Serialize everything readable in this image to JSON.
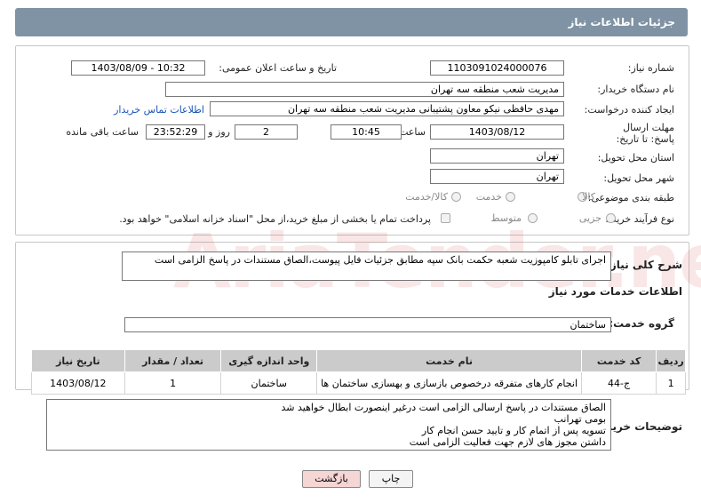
{
  "header": {
    "title": "جزئیات اطلاعات نیاز"
  },
  "form": {
    "need_number_label": "شماره نیاز:",
    "need_number": "1103091024000076",
    "announce_label": "تاریخ و ساعت اعلان عمومی:",
    "announce_value": "1403/08/09 - 10:32",
    "buyer_label": "نام دستگاه خریدار:",
    "buyer_value": "مدیریت شعب منطقه سه تهران",
    "creator_label": "ایجاد کننده درخواست:",
    "creator_value": "مهدی حافظی نیکو معاون پشتیبانی مدیریت شعب منطقه سه تهران",
    "contact_link": "اطلاعات تماس خریدار",
    "deadline_label": "مهلت ارسال پاسخ: تا تاریخ:",
    "deadline_date": "1403/08/12",
    "time_label": "ساعت",
    "deadline_time": "10:45",
    "days_value": "2",
    "days_label": "روز و",
    "remaining_time": "23:52:29",
    "remaining_label": "ساعت باقی مانده",
    "province_label": "استان محل تحویل:",
    "province_value": "تهران",
    "city_label": "شهر محل تحویل:",
    "city_value": "تهران",
    "category_label": "طبقه بندی موضوعی:",
    "category_options": [
      "کالا",
      "خدمت",
      "کالا/خدمت"
    ],
    "process_label": "نوع فرآیند خرید :",
    "process_options": [
      "جزیی",
      "متوسط"
    ],
    "payment_note": "پرداخت تمام یا بخشی از مبلغ خرید،از محل \"اسناد خزانه اسلامی\" خواهد بود."
  },
  "description": {
    "label": "شرح کلی نیاز:",
    "text": "اجرای تابلو کامپوزیت شعبه حکمت بانک سپه مطابق جزئیات فایل پیوست،الصاق مستندات در پاسخ الزامی است"
  },
  "services": {
    "title": "اطلاعات خدمات مورد نیاز",
    "group_label": "گروه خدمت:",
    "group_value": "ساختمان",
    "columns": [
      "ردیف",
      "کد خدمت",
      "نام خدمت",
      "واحد اندازه گیری",
      "تعداد / مقدار",
      "تاریخ نیاز"
    ],
    "rows": [
      [
        "1",
        "ج-44",
        "انجام کارهای متفرقه درخصوص بازسازی و بهسازی ساختمان ها",
        "ساختمان",
        "1",
        "1403/08/12"
      ]
    ]
  },
  "buyer_notes": {
    "label": "توضیحات خریدار:",
    "lines": [
      "الصاق مستندات در پاسخ ارسالی الزامی است درغیر اینصورت ابطال خواهید شد",
      "بومی تهرانب",
      "تسویه پس از اتمام کار و تایید حسن انجام کار",
      "داشتن مجوز های لازم جهت فعالیت الزامی است"
    ]
  },
  "buttons": {
    "print": "چاپ",
    "back": "بازگشت"
  },
  "watermark": "AriaTender.neT",
  "colors": {
    "header": "#7f93a4",
    "link": "#1a55b5",
    "back_button": "#f6d5d5",
    "table_header": "#cbcbcb"
  }
}
